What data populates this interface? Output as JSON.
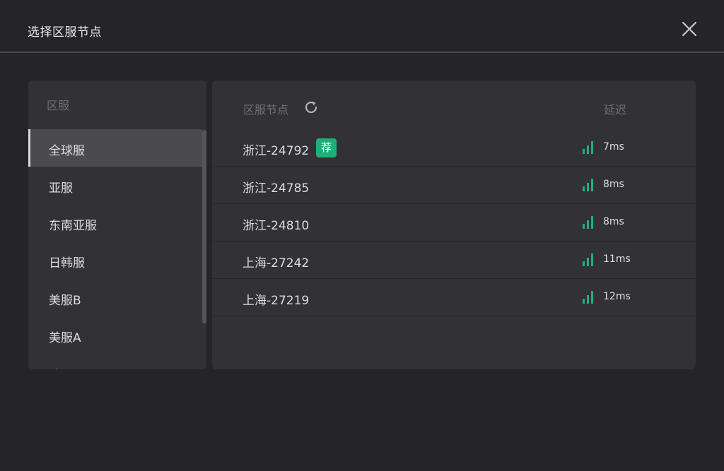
{
  "dialog": {
    "title": "选择区服节点"
  },
  "regions": {
    "header": "区服",
    "items": [
      {
        "label": "全球服",
        "selected": true
      },
      {
        "label": "亚服"
      },
      {
        "label": "东南亚服"
      },
      {
        "label": "日韩服"
      },
      {
        "label": "美服B"
      },
      {
        "label": "美服A"
      },
      {
        "label": "欧服"
      }
    ]
  },
  "nodes": {
    "header": "区服节点",
    "latency_header": "延迟",
    "recommend_badge": "荐",
    "signal_color": "#1fb07a",
    "rows": [
      {
        "name": "浙江-24792",
        "latency": "7ms",
        "recommended": true
      },
      {
        "name": "浙江-24785",
        "latency": "8ms"
      },
      {
        "name": "浙江-24810",
        "latency": "8ms"
      },
      {
        "name": "上海-27242",
        "latency": "11ms"
      },
      {
        "name": "上海-27219",
        "latency": "12ms"
      }
    ]
  }
}
